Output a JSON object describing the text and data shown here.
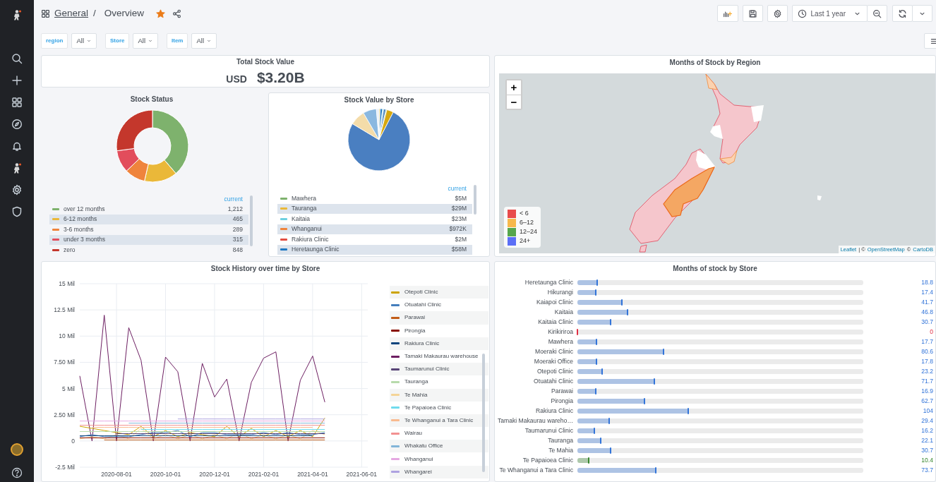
{
  "breadcrumb": {
    "folder": "General",
    "separator": "/",
    "dashboard": "Overview",
    "starred": true
  },
  "toolbar": {
    "time_range": "Last 1 year"
  },
  "variables": [
    {
      "label": "region",
      "value": "All"
    },
    {
      "label": "Store",
      "value": "All"
    },
    {
      "label": "Item",
      "value": "All"
    }
  ],
  "total_stock_value": {
    "title": "Total Stock Value",
    "prefix": "USD",
    "value": "$3.20B"
  },
  "stock_status": {
    "title": "Stock Status",
    "chart_data": {
      "type": "donut",
      "categories": [
        "over 12 months",
        "6-12 months",
        "3-6 months",
        "under 3 months",
        "zero"
      ],
      "values": [
        38.73,
        14.86,
        9.24,
        10.07,
        27.1
      ]
    },
    "legend_header": "current",
    "legend": [
      {
        "value": "1,212",
        "color": "#7eb26d"
      },
      {
        "value": "465",
        "color": "#eab839"
      },
      {
        "value": "289",
        "color": "#ef843c"
      },
      {
        "value": "315",
        "color": "#e24d5c"
      },
      {
        "value": "848",
        "color": "#c4372c"
      }
    ]
  },
  "stock_value_by_store": {
    "title": "Stock Value by Store",
    "legend_header": "current",
    "legend": [
      {
        "name": "Mawhera",
        "value": "$5M",
        "color": "#7eb26d"
      },
      {
        "name": "Tauranga",
        "value": "$29M",
        "color": "#eab839"
      },
      {
        "name": "Kaitaia",
        "value": "$23M",
        "color": "#6ed0e0"
      },
      {
        "name": "Whanganui",
        "value": "$972K",
        "color": "#ef843c"
      },
      {
        "name": "Rakiura Clinic",
        "value": "$2M",
        "color": "#e24d42"
      },
      {
        "name": "Heretaunga Clinic",
        "value": "$58M",
        "color": "#1f78c1"
      }
    ]
  },
  "months_of_stock_by_region": {
    "title": "Months of Stock by Region",
    "zoom_in": "+",
    "zoom_out": "−",
    "legend": [
      {
        "label": "< 6",
        "color": "#e84b4b"
      },
      {
        "label": "6–12",
        "color": "#f7b84b"
      },
      {
        "label": "12–24",
        "color": "#56a64b"
      },
      {
        "label": "24+",
        "color": "#5b6ff6"
      }
    ],
    "attribution": [
      {
        "kind": "link",
        "text": "Leaflet"
      },
      {
        "kind": "text",
        "text": "| ©"
      },
      {
        "kind": "link",
        "text": "OpenStreetMap"
      },
      {
        "kind": "text",
        "text": "©"
      },
      {
        "kind": "link",
        "text": "CartoDB"
      }
    ]
  },
  "stock_history": {
    "title": "Stock History over time by Store",
    "chart_data": {
      "type": "line",
      "grid": true,
      "ylim": [
        -2.5,
        15
      ],
      "categories": [
        null,
        null,
        null,
        "2020-08-01",
        null,
        null,
        null,
        "2020-10-01",
        null,
        null,
        null,
        "2020-12-01",
        null,
        null,
        null,
        "2021-02-01",
        null,
        null,
        null,
        "2021-04-01",
        null,
        null,
        null,
        "2021-06-01"
      ],
      "yticks": [
        {
          "value": 15,
          "label": "15 Mil"
        },
        {
          "value": 12.5,
          "label": "12.5 Mil"
        },
        {
          "value": 10,
          "label": "10 Mil"
        },
        {
          "value": 7.5,
          "label": "7.50 Mil"
        },
        {
          "value": 5,
          "label": "5 Mil"
        },
        {
          "value": 2.5,
          "label": "2.50 Mil"
        },
        {
          "value": 0,
          "label": "0"
        },
        {
          "value": -2.5,
          "label": "-2.5 Mil"
        }
      ],
      "series": [
        {
          "name": "Otepoti Clinic",
          "color": "#cca300",
          "values": [
            1.4,
            1.2,
            1.0,
            0.8,
            0.6,
            1.4,
            0.4,
            1.0,
            0.4,
            0.8,
            0.6,
            0.4,
            1.4,
            0.4,
            1.2,
            0.4,
            1.0,
            0.4,
            1.0,
            0.4,
            2.2,
            null,
            null,
            null
          ]
        },
        {
          "name": "Otuatahi Clinic",
          "color": "#447ebc",
          "values": [
            0.4,
            0.6,
            0.4,
            0.4,
            0.4,
            0.6,
            0.8,
            0.8,
            1.0,
            0.4,
            0.8,
            0.8,
            0.6,
            0.6,
            0.6,
            0.8,
            0.6,
            0.8,
            0.6,
            0.6,
            0.8,
            null,
            null,
            null
          ]
        },
        {
          "name": "Parawai",
          "color": "#c15c17",
          "values": [
            null,
            null,
            0.1,
            0.1,
            0.1,
            0.1,
            0.1,
            0.1,
            0.1,
            0.1,
            0.1,
            0.1,
            0.1,
            0.1,
            0.1,
            0.1,
            0.1,
            0.1,
            0.1,
            0.1,
            0.1,
            null,
            null,
            null
          ]
        },
        {
          "name": "Pirongia",
          "color": "#890f02",
          "values": [
            0.3,
            0.3,
            0.3,
            0.3,
            0.3,
            0.3,
            0.3,
            0.3,
            0.3,
            0.3,
            0.3,
            0.3,
            0.3,
            0.3,
            0.3,
            0.3,
            0.3,
            0.3,
            0.3,
            0.3,
            0.3,
            null,
            null,
            null
          ]
        },
        {
          "name": "Rakiura Clinic",
          "color": "#0a437c",
          "values": [
            0.5,
            0.5,
            0.5,
            0.5,
            0.5,
            0.5,
            0.5,
            0.5,
            0.5,
            0.5,
            0.5,
            0.5,
            0.5,
            0.5,
            0.5,
            0.5,
            0.5,
            0.5,
            0.5,
            0.5,
            null,
            null,
            null,
            null
          ]
        },
        {
          "name": "Tamaki Makaurau warehouse",
          "color": "#6d1f62",
          "values": [
            6.2,
            0,
            12,
            0,
            10.8,
            7.7,
            0,
            8,
            6.6,
            0,
            7.4,
            4.2,
            5.9,
            0,
            5.6,
            7.9,
            8.5,
            0,
            5.8,
            8.1,
            3.7,
            null,
            null,
            null
          ]
        },
        {
          "name": "Taumarunui Clinic",
          "color": "#584477",
          "values": [
            null,
            null,
            null,
            0.7,
            0.7,
            0.7,
            0.7,
            0.7,
            0.7,
            0.7,
            0.7,
            0.7,
            0.7,
            0.7,
            0.7,
            0.7,
            0.7,
            0.7,
            0.7,
            0.7,
            0.7,
            null,
            null,
            null
          ]
        },
        {
          "name": "Tauranga",
          "color": "#b7dbab",
          "values": [
            0.9,
            0.9,
            0.9,
            0.9,
            0.9,
            0.9,
            0.9,
            0.9,
            0.9,
            0.9,
            0.9,
            0.9,
            0.9,
            0.9,
            0.9,
            0.9,
            0.9,
            0.9,
            0.9,
            0.9,
            0.9,
            null,
            null,
            null
          ]
        },
        {
          "name": "Te Mahia",
          "color": "#f4d598",
          "values": [
            0.2,
            0.4,
            0.2,
            0.6,
            0.2,
            1.2,
            0.2,
            0.6,
            0.2,
            0.6,
            0.2,
            0.6,
            0.2,
            0.8,
            0.2,
            0.6,
            0.2,
            0.6,
            0.2,
            1.0,
            0.6,
            null,
            null,
            null
          ]
        },
        {
          "name": "Te Papaioea Clinic",
          "color": "#70dbed",
          "values": [
            null,
            null,
            null,
            null,
            null,
            1.1,
            1.1,
            1.1,
            1.1,
            1.1,
            1.1,
            1.1,
            1.1,
            1.1,
            1.1,
            1.1,
            1.1,
            1.1,
            1.1,
            1.1,
            1.1,
            null,
            null,
            null
          ]
        },
        {
          "name": "Te Whanganui a Tara Clinic",
          "color": "#f9ba8f",
          "values": [
            null,
            1.3,
            1.3,
            1.3,
            1.3,
            1.3,
            1.3,
            1.3,
            1.3,
            1.3,
            1.3,
            1.3,
            1.3,
            1.3,
            1.3,
            1.3,
            1.3,
            1.3,
            1.3,
            1.3,
            null,
            null,
            null,
            null
          ]
        },
        {
          "name": "Wairau",
          "color": "#f29191",
          "values": [
            1.5,
            1.5,
            1.5,
            1.5,
            1.5,
            1.5,
            1.5,
            1.5,
            1.5,
            1.5,
            1.5,
            1.5,
            1.5,
            1.5,
            1.5,
            1.5,
            1.5,
            1.5,
            1.5,
            1.5,
            1.5,
            null,
            null,
            null
          ]
        },
        {
          "name": "Whakatu Office",
          "color": "#82b5d8",
          "values": [
            null,
            null,
            null,
            null,
            1.7,
            1.7,
            1.7,
            1.7,
            1.7,
            1.7,
            1.7,
            1.7,
            1.7,
            1.7,
            1.7,
            1.7,
            1.7,
            1.7,
            1.7,
            1.7,
            1.7,
            null,
            null,
            null
          ]
        },
        {
          "name": "Whanganui",
          "color": "#e5a8e2",
          "values": [
            1.9,
            1.9,
            1.9,
            1.9,
            1.9,
            1.9,
            1.9,
            1.9,
            1.9,
            1.9,
            1.9,
            1.9,
            1.9,
            1.9,
            1.9,
            1.9,
            1.9,
            1.9,
            1.9,
            1.9,
            1.9,
            null,
            null,
            null
          ]
        },
        {
          "name": "Whangarei",
          "color": "#aea2e0",
          "values": [
            null,
            null,
            null,
            null,
            null,
            null,
            null,
            null,
            2.1,
            2.1,
            2.1,
            2.1,
            2.1,
            2.1,
            2.1,
            2.1,
            2.1,
            2.1,
            2.1,
            2.1,
            2.1,
            null,
            null,
            null
          ]
        }
      ]
    }
  },
  "months_of_stock_by_store": {
    "title": "Months of stock by Store",
    "rows": [
      {
        "name": "Heretaunga Clinic",
        "reading": "18.8",
        "level": 0.07,
        "color": "#3274d9"
      },
      {
        "name": "Hikurangi",
        "reading": "17.4",
        "level": 0.065,
        "color": "#3274d9"
      },
      {
        "name": "Kaiapoi Clinic",
        "reading": "41.7",
        "level": 0.156,
        "color": "#3274d9"
      },
      {
        "name": "Kaitaia",
        "reading": "46.8",
        "level": 0.175,
        "color": "#3274d9"
      },
      {
        "name": "Kaitaia Clinic",
        "reading": "30.7",
        "level": 0.115,
        "color": "#3274d9"
      },
      {
        "name": "Kirikiriroa",
        "reading": "0",
        "level": 0,
        "color": "#e02f44"
      },
      {
        "name": "Mawhera",
        "reading": "17.7",
        "level": 0.066,
        "color": "#3274d9"
      },
      {
        "name": "Moeraki Clinic",
        "reading": "80.6",
        "level": 0.3,
        "color": "#3274d9"
      },
      {
        "name": "Moeraki Office",
        "reading": "17.8",
        "level": 0.066,
        "color": "#3274d9"
      },
      {
        "name": "Otepoti Clinic",
        "reading": "23.2",
        "level": 0.087,
        "color": "#3274d9"
      },
      {
        "name": "Otuatahi Clinic",
        "reading": "71.7",
        "level": 0.268,
        "color": "#3274d9"
      },
      {
        "name": "Parawai",
        "reading": "16.9",
        "level": 0.063,
        "color": "#3274d9"
      },
      {
        "name": "Pirongia",
        "reading": "62.7",
        "level": 0.234,
        "color": "#3274d9"
      },
      {
        "name": "Rakiura Clinic",
        "reading": "104",
        "level": 0.388,
        "color": "#3274d9"
      },
      {
        "name": "Tamaki Makaurau wareho…",
        "reading": "29.4",
        "level": 0.11,
        "color": "#3274d9"
      },
      {
        "name": "Taumarunui Clinic",
        "reading": "16.2",
        "level": 0.06,
        "color": "#3274d9"
      },
      {
        "name": "Tauranga",
        "reading": "22.1",
        "level": 0.082,
        "color": "#3274d9"
      },
      {
        "name": "Te Mahia",
        "reading": "30.7",
        "level": 0.115,
        "color": "#3274d9"
      },
      {
        "name": "Te Papaioea Clinic",
        "reading": "10.4",
        "level": 0.039,
        "color": "#37872d"
      },
      {
        "name": "Te Whanganui a Tara Clinic",
        "reading": "73.7",
        "level": 0.275,
        "color": "#3274d9"
      }
    ]
  }
}
